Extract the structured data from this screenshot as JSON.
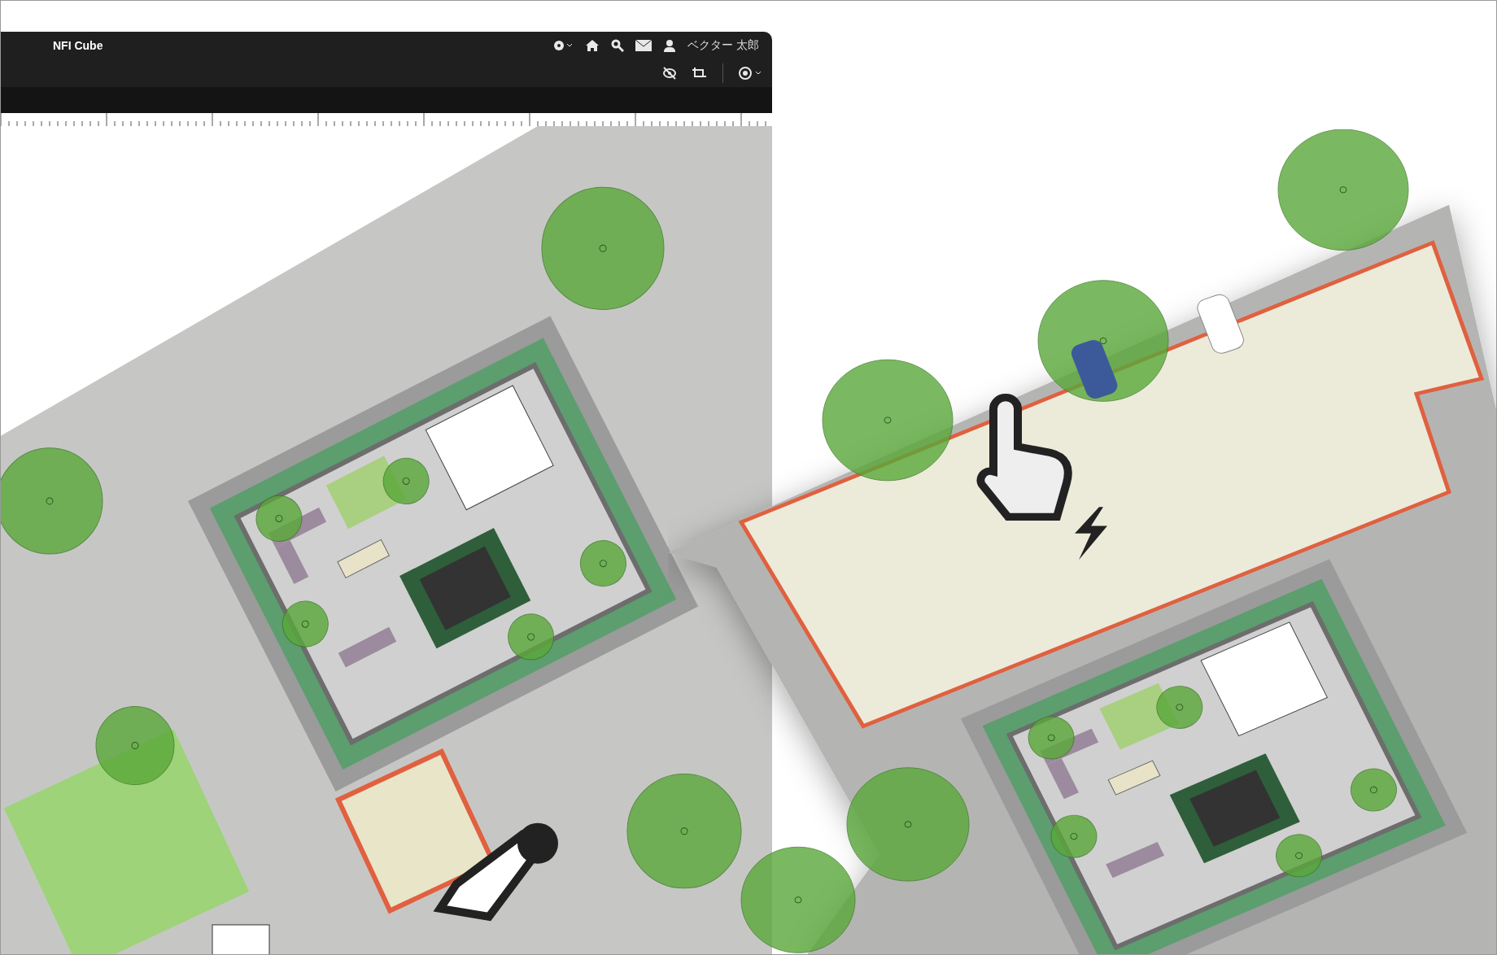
{
  "app": {
    "title": "NFI Cube"
  },
  "user": {
    "name": "ベクター 太郎"
  }
}
